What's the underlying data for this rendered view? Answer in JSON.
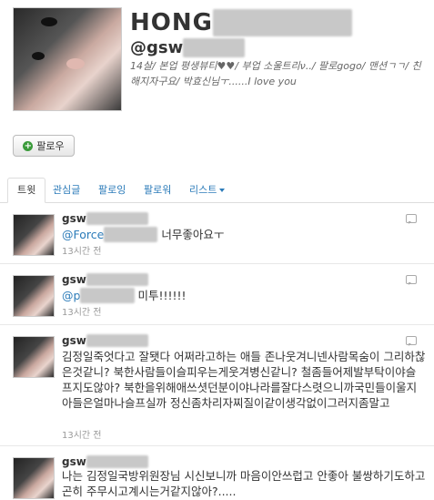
{
  "profile": {
    "name": "HONG",
    "name_hidden": "■■■■■■",
    "handle": "@gsw",
    "handle_hidden": "■■■■",
    "bio": "14살/ 본업 평생뷰티♥♥/ 부업 소울트리ν../ 팔로gogo/ 맨션ㄱㄱ/ 친해지자구요/ 박효신님ㅜ......I love you"
  },
  "actions": {
    "follow_label": "팔로우",
    "follow_icon": "plus-icon"
  },
  "tabs": [
    {
      "label": "트윗",
      "active": true
    },
    {
      "label": "관심글",
      "active": false
    },
    {
      "label": "팔로잉",
      "active": false
    },
    {
      "label": "팔로워",
      "active": false
    },
    {
      "label": "리스트",
      "active": false
    }
  ],
  "tweets": [
    {
      "user": "gsw",
      "mention": "@Force",
      "text": "너무좋아요ㅜ",
      "time": "13시간 전"
    },
    {
      "user": "gsw",
      "mention": "@p",
      "text": "미투!!!!!!",
      "time": "13시간 전"
    },
    {
      "user": "gsw",
      "mention": "",
      "text": "김정일죽엇다고 잘됏다 어쩌라고하는 애들 존나웃겨니넨사람목숨이 그리하찮은것같니? 북한사람들이슬피우는게웃겨병신같니? 철좀들어제발부탁이야슬프지도않아? 북한을위해애쓰셧던분이야나라를잘다스렷으니까국민들이울지아들은얼마나슬프실까 정신좀차리자찌질이같이생각없이그러지좀말고",
      "time": "13시간 전"
    },
    {
      "user": "gsw",
      "mention": "",
      "text": "나는 김정일국방위원장님 시신보니까 마음이안쓰럽고 안좋아 불쌍하기도하고 곤히 주무시고계시는거같지않아?.....",
      "time": ""
    }
  ]
}
